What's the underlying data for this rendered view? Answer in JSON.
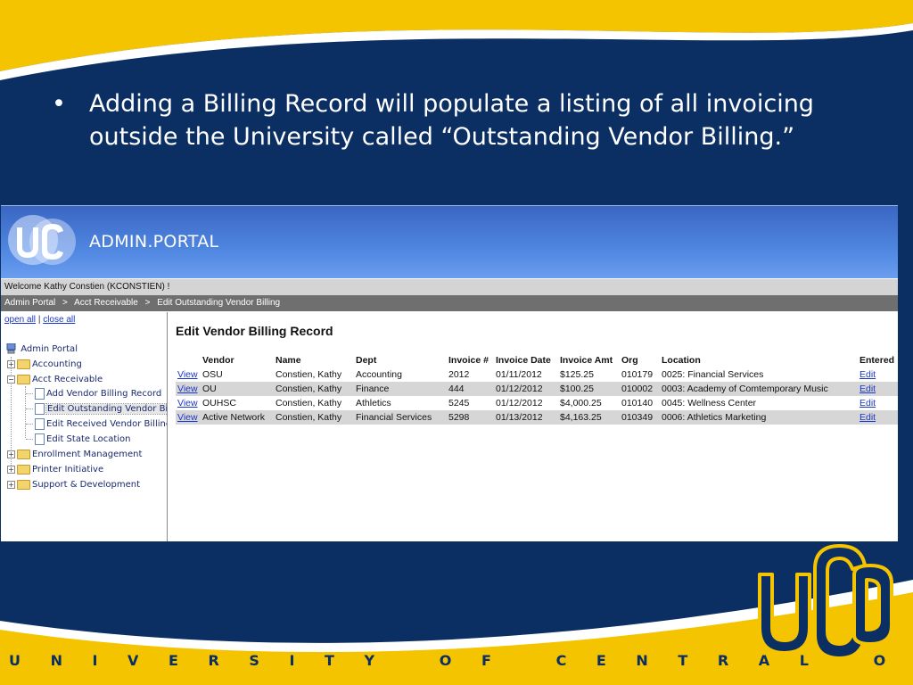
{
  "slide": {
    "bullet": "Adding a Billing Record will populate a listing of all invoicing outside the University called “Outstanding Vendor Billing.”",
    "footer": "U N I V E R S I T Y   O F   C E N T R A L   O K L A H O M A",
    "colors": {
      "navy": "#0b2f63",
      "gold": "#f5c400"
    }
  },
  "portal": {
    "title": "ADMIN.PORTAL",
    "logo_icon": "uco-logo",
    "welcome": "Welcome Kathy Constien (KCONSTIEN) !",
    "breadcrumb": [
      "Admin Portal",
      "Acct Receivable",
      "Edit Outstanding Vendor Billing"
    ],
    "breadcrumb_sep": ">"
  },
  "sidebar": {
    "open_all": "open all",
    "sep": "|",
    "close_all": "close all",
    "root": "Admin Portal",
    "nodes": [
      {
        "label": "Accounting",
        "toggle": "+"
      },
      {
        "label": "Acct Receivable",
        "toggle": "−"
      },
      {
        "label": "Add Vendor Billing Record"
      },
      {
        "label": "Edit Outstanding Vendor Billing"
      },
      {
        "label": "Edit Received Vendor Billing"
      },
      {
        "label": "Edit State Location"
      },
      {
        "label": "Enrollment Management",
        "toggle": "+"
      },
      {
        "label": "Printer Initiative",
        "toggle": "+"
      },
      {
        "label": "Support & Development",
        "toggle": "+"
      }
    ]
  },
  "main": {
    "title": "Edit Vendor Billing Record",
    "columns": [
      "",
      "Vendor",
      "Name",
      "Dept",
      "Invoice #",
      "Invoice Date",
      "Invoice Amt",
      "Org",
      "Location",
      "Entered"
    ],
    "rows": [
      {
        "view": "View",
        "vendor": "OSU",
        "name": "Constien, Kathy",
        "dept": "Accounting",
        "invoice": "2012",
        "date": "01/11/2012",
        "amt": "$125.25",
        "org": "010179",
        "location": "0025: Financial Services",
        "edit": "Edit"
      },
      {
        "view": "View",
        "vendor": "OU",
        "name": "Constien, Kathy",
        "dept": "Finance",
        "invoice": "444",
        "date": "01/12/2012",
        "amt": "$100.25",
        "org": "010002",
        "location": "0003: Academy of Comtemporary Music",
        "edit": "Edit"
      },
      {
        "view": "View",
        "vendor": "OUHSC",
        "name": "Constien, Kathy",
        "dept": "Athletics",
        "invoice": "5245",
        "date": "01/12/2012",
        "amt": "$4,000.25",
        "org": "010140",
        "location": "0045: Wellness Center",
        "edit": "Edit"
      },
      {
        "view": "View",
        "vendor": "Active Network",
        "name": "Constien, Kathy",
        "dept": "Financial Services",
        "invoice": "5298",
        "date": "01/13/2012",
        "amt": "$4,163.25",
        "org": "010349",
        "location": "0006: Athletics Marketing",
        "edit": "Edit"
      }
    ]
  }
}
